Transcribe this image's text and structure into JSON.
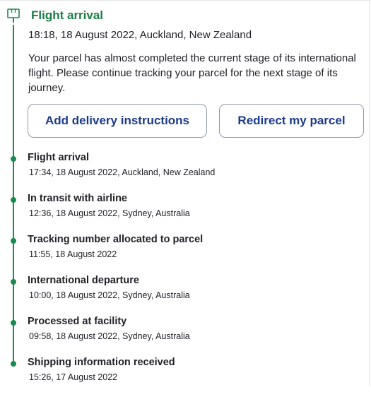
{
  "current": {
    "title": "Flight arrival",
    "datetime": "18:18, 18 August 2022, Auckland, New Zealand",
    "description": "Your parcel has almost completed the current stage of its international flight. Please continue tracking your parcel for the next stage of its journey."
  },
  "actions": {
    "add_instructions_label": "Add delivery instructions",
    "redirect_label": "Redirect my parcel"
  },
  "events": [
    {
      "title": "Flight arrival",
      "detail": "17:34, 18 August 2022, Auckland, New Zealand"
    },
    {
      "title": "In transit with airline",
      "detail": "12:36, 18 August 2022, Sydney, Australia"
    },
    {
      "title": "Tracking number allocated to parcel",
      "detail": "11:55, 18 August 2022"
    },
    {
      "title": "International departure",
      "detail": "10:00, 18 August 2022, Sydney, Australia"
    },
    {
      "title": "Processed at facility",
      "detail": "09:58, 18 August 2022, Sydney, Australia"
    },
    {
      "title": "Shipping information received",
      "detail": "15:26, 17 August 2022"
    }
  ],
  "colors": {
    "accent_green": "#1b7d45",
    "button_text": "#1a3a8a",
    "button_border": "#8d9aaf"
  }
}
